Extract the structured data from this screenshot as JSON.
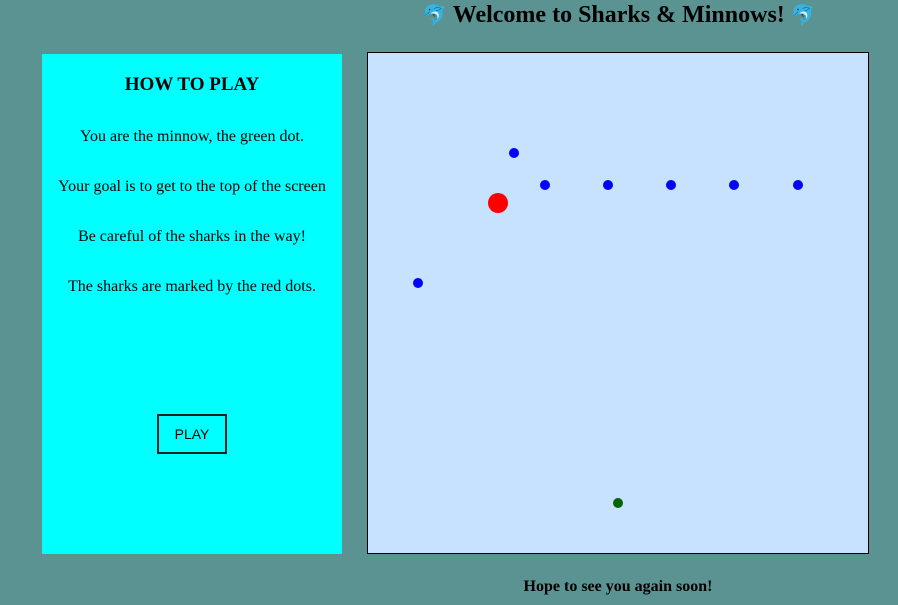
{
  "header": {
    "icon": "dolphin-icon",
    "icon_glyph": "🐬",
    "title": "Welcome to Sharks & Minnows!"
  },
  "instructions": {
    "heading": "HOW TO PLAY",
    "lines": [
      "You are the minnow, the green dot.",
      "Your goal is to get to the top of the screen",
      "Be careful of the sharks in the way!",
      "The sharks are marked by the red dots."
    ],
    "play_label": "PLAY"
  },
  "board": {
    "background": "#c6e2ff",
    "minnow": {
      "color": "#006400"
    },
    "shark": {
      "color": "#ff0000"
    },
    "blue_dots": {
      "color": "#0000ff",
      "count": 7
    }
  },
  "footer": {
    "text": "Hope to see you again soon!"
  },
  "colors": {
    "page_bg": "#5b9393",
    "panel_bg": "#00ffff"
  }
}
